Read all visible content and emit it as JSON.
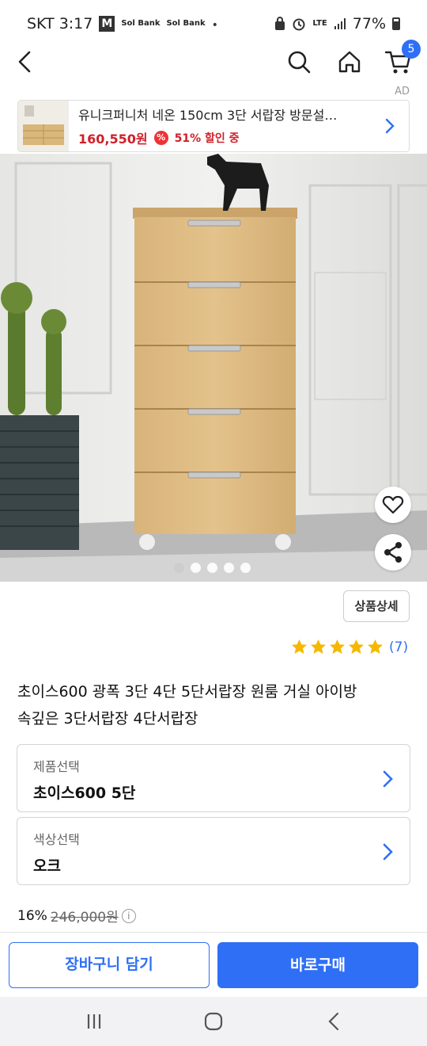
{
  "status_bar": {
    "carrier_time": "SKT 3:17",
    "mail_icon_letter": "M",
    "bank_icon_1": "Sol Bank",
    "bank_icon_2": "Sol Bank",
    "dot": "•",
    "network_label": "LTE",
    "battery": "77%"
  },
  "header": {
    "back_icon": "back-arrow-icon",
    "search_icon": "search-icon",
    "home_icon": "home-icon",
    "cart_icon": "cart-icon",
    "cart_count": "5",
    "ad_label": "AD"
  },
  "ad_banner": {
    "title": "유니크퍼니처 네온 150cm 3단 서랍장 방문설…",
    "price": "160,550원",
    "percent_icon": "%",
    "discount": "51% 할인 중"
  },
  "gallery": {
    "slide_count": 5,
    "active_index": 0
  },
  "actions": {
    "detail_button": "상품상세"
  },
  "rating": {
    "stars": 5,
    "count": "(7)"
  },
  "product": {
    "title_line1": "초이스600 광폭 3단 4단 5단서랍장 원룸 거실 아이방",
    "title_line2": "속깊은 3단서랍장 4단서랍장"
  },
  "options": [
    {
      "label": "제품선택",
      "value": "초이스600 5단"
    },
    {
      "label": "색상선택",
      "value": "오크"
    }
  ],
  "price": {
    "discount_rate": "16%",
    "original_price": "246,000원",
    "info_icon": "i"
  },
  "bottom_bar": {
    "cart_button": "장바구니 담기",
    "buy_button": "바로구매"
  },
  "colors": {
    "accent": "#2f6ff6",
    "sale_red": "#d0202a",
    "star_yellow": "#f5b800"
  }
}
